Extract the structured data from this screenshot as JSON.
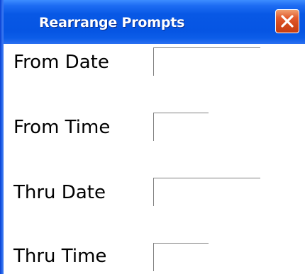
{
  "window": {
    "title": "Rearrange Prompts",
    "close_icon": "close-icon"
  },
  "fields": [
    {
      "label": "From Date",
      "value": ""
    },
    {
      "label": "From Time",
      "value": ""
    },
    {
      "label": "Thru Date",
      "value": ""
    },
    {
      "label": "Thru Time",
      "value": ""
    }
  ],
  "colors": {
    "titlebar": "#0655e3",
    "close_button": "#d44a1c",
    "background": "#ffffff",
    "input_border": "#808080"
  }
}
